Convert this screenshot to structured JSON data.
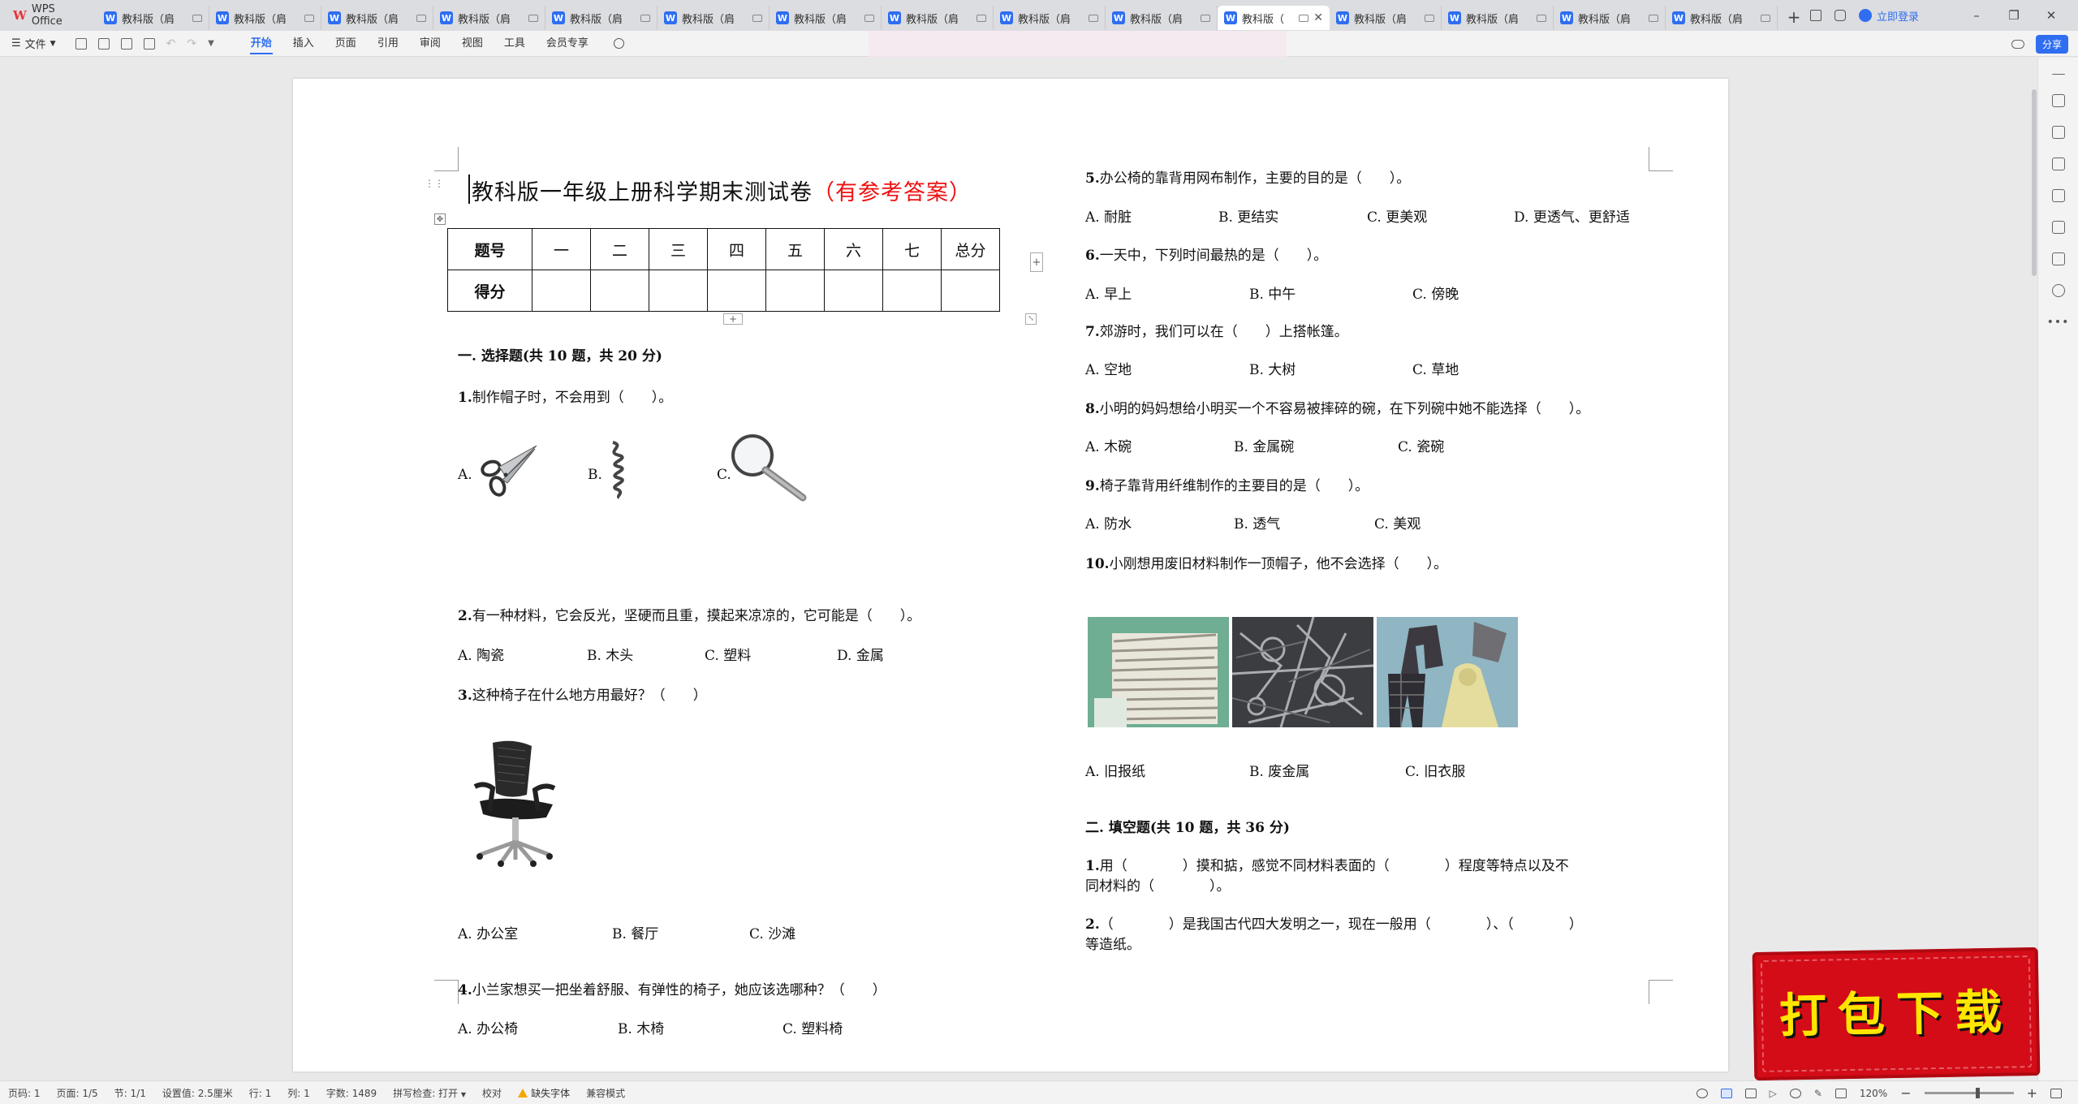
{
  "app": {
    "name": "WPS Office"
  },
  "tabs": [
    {
      "label": "教科版（肩",
      "active": false
    },
    {
      "label": "教科版（肩",
      "active": false
    },
    {
      "label": "教科版（肩",
      "active": false
    },
    {
      "label": "教科版（肩",
      "active": false
    },
    {
      "label": "教科版（肩",
      "active": false
    },
    {
      "label": "教科版（肩",
      "active": false
    },
    {
      "label": "教科版（肩",
      "active": false
    },
    {
      "label": "教科版（肩",
      "active": false
    },
    {
      "label": "教科版（肩",
      "active": false
    },
    {
      "label": "教科版（肩",
      "active": false
    },
    {
      "label": "教科版（",
      "active": true
    },
    {
      "label": "教科版（肩",
      "active": false
    },
    {
      "label": "教科版（肩",
      "active": false
    },
    {
      "label": "教科版（肩",
      "active": false
    },
    {
      "label": "教科版（肩",
      "active": false
    }
  ],
  "tab_add": "+",
  "login_label": "立即登录",
  "ribbon": {
    "file_label": "文件",
    "menu": [
      "开始",
      "插入",
      "页面",
      "引用",
      "审阅",
      "视图",
      "工具",
      "会员专享"
    ],
    "active_menu": "开始",
    "share_label": "分享"
  },
  "document": {
    "title_main": "教科版一年级上册科学期末测试卷",
    "title_note": "（有参考答案）",
    "score_table": {
      "row1": [
        "题号",
        "一",
        "二",
        "三",
        "四",
        "五",
        "六",
        "七",
        "总分"
      ],
      "row2": [
        "得分",
        "",
        "",
        "",
        "",
        "",
        "",
        "",
        ""
      ]
    },
    "section1": "一. 选择题(共 10 题，共 20 分)",
    "q1": {
      "num": "1.",
      "text": "制作帽子时，不会用到（　　）。",
      "a": "A.",
      "b": "B.",
      "c": "C."
    },
    "q2": {
      "num": "2.",
      "text": "有一种材料，它会反光，坚硬而且重，摸起来凉凉的，它可能是（　　）。",
      "opts": [
        "A. 陶瓷",
        "B. 木头",
        "C. 塑料",
        "D. 金属"
      ]
    },
    "q3": {
      "num": "3.",
      "text": "这种椅子在什么地方用最好？（　　）",
      "opts": [
        "A. 办公室",
        "B. 餐厅",
        "C. 沙滩"
      ]
    },
    "q4": {
      "num": "4.",
      "text": "小兰家想买一把坐着舒服、有弹性的椅子，她应该选哪种？（　　）",
      "opts": [
        "A. 办公椅",
        "B. 木椅",
        "C. 塑料椅"
      ]
    },
    "q5": {
      "num": "5.",
      "text": "办公椅的靠背用网布制作，主要的目的是（　　）。",
      "opts": [
        "A. 耐脏",
        "B. 更结实",
        "C. 更美观",
        "D. 更透气、更舒适"
      ]
    },
    "q6": {
      "num": "6.",
      "text": "一天中，下列时间最热的是（　　）。",
      "opts": [
        "A. 早上",
        "B. 中午",
        "C. 傍晚"
      ]
    },
    "q7": {
      "num": "7.",
      "text": "郊游时，我们可以在（　　）上搭帐篷。",
      "opts": [
        "A. 空地",
        "B. 大树",
        "C. 草地"
      ]
    },
    "q8": {
      "num": "8.",
      "text": "小明的妈妈想给小明买一个不容易被摔碎的碗，在下列碗中她不能选择（　　）。",
      "opts": [
        "A. 木碗",
        "B. 金属碗",
        "C. 瓷碗"
      ]
    },
    "q9": {
      "num": "9.",
      "text": "椅子靠背用纤维制作的主要目的是（　　）。",
      "opts": [
        "A. 防水",
        "B. 透气",
        "C. 美观"
      ]
    },
    "q10": {
      "num": "10.",
      "text": "小刚想用废旧材料制作一顶帽子，他不会选择（　　）。",
      "opts": [
        "A. 旧报纸",
        "B. 废金属",
        "C. 旧衣服"
      ]
    },
    "section2": "二. 填空题(共 10 题，共 36 分)",
    "f1": {
      "num": "1.",
      "line1": "用（　　　　）摸和掂，感觉不同材料表面的（　　　　）程度等特点以及不",
      "line2": "同材料的（　　　　）。"
    },
    "f2": {
      "num": "2.",
      "line1": "（　　　　）是我国古代四大发明之一，现在一般用（　　　　）、（　　　　）",
      "line2": "等造纸。"
    }
  },
  "promo_text": "打包下载",
  "status": {
    "page": "页码: 1",
    "pages": "页面: 1/5",
    "section": "节: 1/1",
    "setting": "设置值: 2.5厘米",
    "line": "行: 1",
    "column": "列: 1",
    "words": "字数: 1489",
    "spell": "拼写检查: 打开",
    "proof": "校对",
    "missing_font": "缺失字体",
    "compat": "兼容模式",
    "zoom": "120%",
    "zoom_fraction": 0.6
  },
  "colors": {
    "accent": "#2f6ef0",
    "title_red": "#e11",
    "promo_red": "#d40c17",
    "promo_yellow": "#ffe600"
  }
}
